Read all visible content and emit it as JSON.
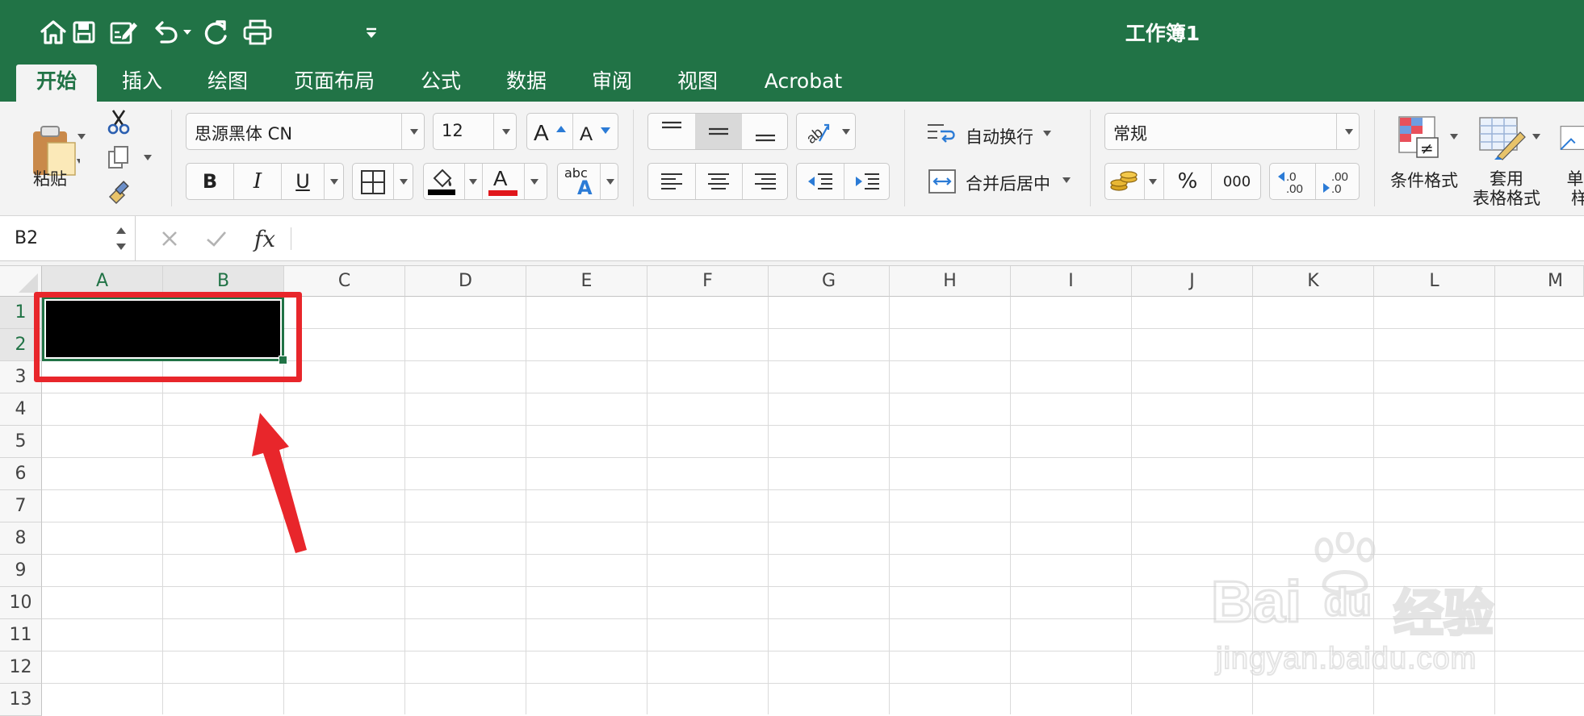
{
  "window": {
    "title": "工作簿1"
  },
  "tabs": [
    {
      "label": "开始",
      "active": true
    },
    {
      "label": "插入"
    },
    {
      "label": "绘图"
    },
    {
      "label": "页面布局"
    },
    {
      "label": "公式"
    },
    {
      "label": "数据"
    },
    {
      "label": "审阅"
    },
    {
      "label": "视图"
    },
    {
      "label": "Acrobat"
    }
  ],
  "ribbon": {
    "paste_label": "粘贴",
    "font_name": "思源黑体 CN",
    "font_size": "12",
    "bold": "B",
    "italic": "I",
    "underline": "U",
    "font_color_glyph": "A",
    "text_effect_top": "abc",
    "text_effect_bottom": "A",
    "wrap_text_label": "自动换行",
    "merge_center_label": "合并后居中",
    "number_format": "常规",
    "percent": "%",
    "thousands": "000",
    "cond_format_label": "条件格式",
    "table_format_label_1": "套用",
    "table_format_label_2": "表格格式",
    "cell_style_label_1": "单",
    "cell_style_label_2": "样",
    "colors": {
      "fill_color": "#000000",
      "font_color": "#e0161b",
      "accent": "#217346"
    }
  },
  "formula_bar": {
    "name_box": "B2",
    "fx": "fx",
    "value": ""
  },
  "sheet": {
    "columns": [
      "A",
      "B",
      "C",
      "D",
      "E",
      "F",
      "G",
      "H",
      "I",
      "J",
      "K",
      "L",
      "M"
    ],
    "rows": [
      "1",
      "2",
      "3",
      "4",
      "5",
      "6",
      "7",
      "8",
      "9",
      "10",
      "11",
      "12",
      "13"
    ],
    "selected_range": "A1:B2",
    "selection_fill": "#000000",
    "annotation_color": "#e8262b"
  },
  "watermark": {
    "line1": "Bai",
    "line1b": "du",
    "line1c": "经验",
    "line2": "jingyan.baidu.com"
  }
}
